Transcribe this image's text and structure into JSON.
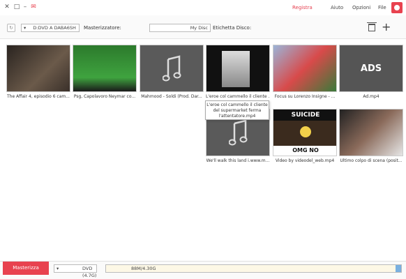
{
  "menu": {
    "file": "File",
    "opzioni": "Opzioni",
    "aiuto": "Aiuto",
    "registra": "Registra"
  },
  "toolbar": {
    "etichetta_label": "Etichetta Disco:",
    "etichetta_value": "My Disc",
    "masterizzatore_label": "Masterizzatore:",
    "masterizzatore_value": "D:DVD A  DABA6SH",
    "dropdown_arrow": "▾"
  },
  "items": [
    {
      "caption": "Ad.mp4",
      "kind": "ads",
      "thumb_text": "ADS"
    },
    {
      "caption": "Focus su Lorenzo Insigne - ...",
      "kind": "football"
    },
    {
      "caption": "L'eroe col cammello il cliente ...",
      "kind": "camel"
    },
    {
      "caption": "Mahmood - Soldi (Prod. Dar...",
      "kind": "music"
    },
    {
      "caption": "Psg, Capolavoro Neymar co...",
      "kind": "soccer"
    },
    {
      "caption": "The Affair 4, episodio 6 cam...",
      "kind": "drama"
    },
    {
      "caption": "Ultimo colpo di scena (posit...",
      "kind": "woman"
    },
    {
      "caption": "Video by videodel_web.mp4",
      "kind": "suicide",
      "thumb_text": "SUICIDE",
      "thumb_text2": "OMG NO"
    },
    {
      "caption": "We'll walk this land i.www.m...",
      "kind": "music"
    }
  ],
  "tooltip": {
    "line1": "L'eroe col cammello il cliente",
    "line2": "del supermarket ferma",
    "line3": "l'attentatore.mp4"
  },
  "bottom": {
    "burn_label": "Masterizza",
    "dvd_value": "DVD (4.7G)",
    "capacity_text": "88M/4.30G",
    "capacity_used_fraction": 0.02
  },
  "colors": {
    "accent": "#e8424f",
    "capacity_fill": "#7ab0e0"
  }
}
